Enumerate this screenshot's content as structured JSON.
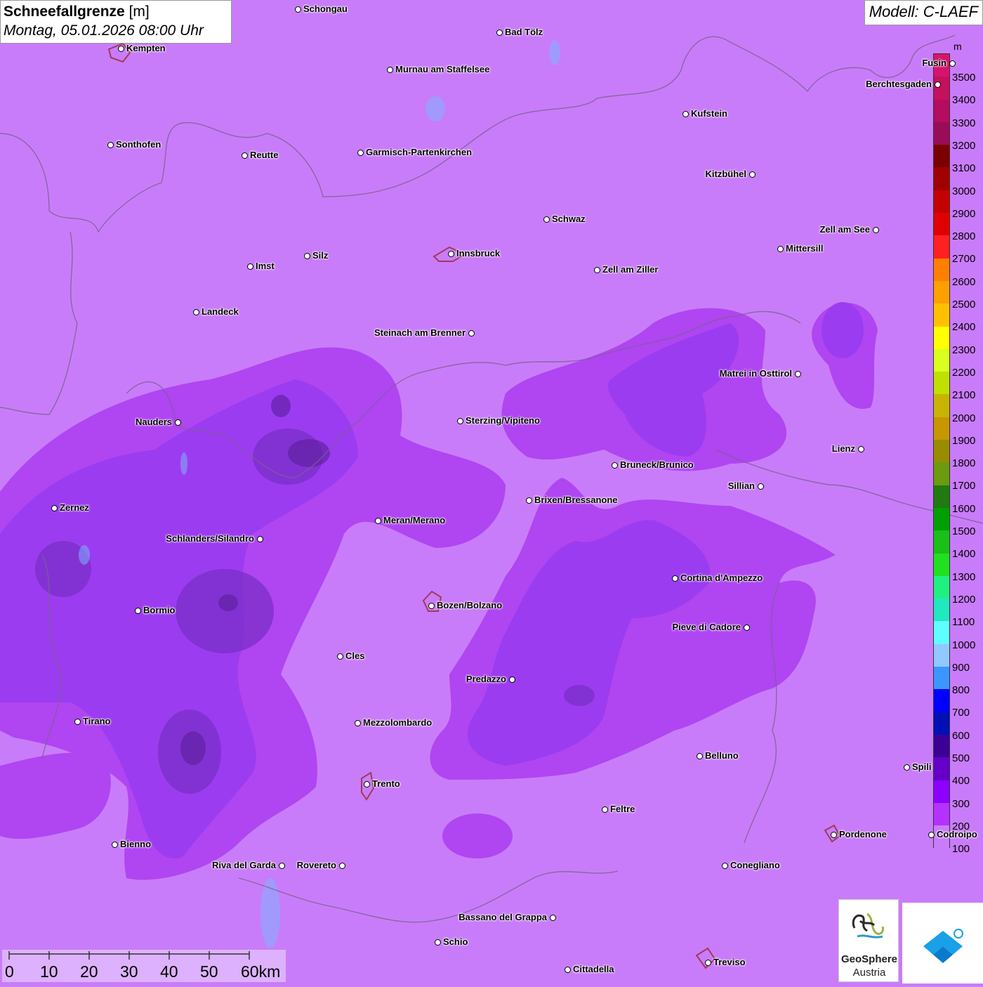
{
  "title": {
    "main": "Schneefallgrenze",
    "unit": "[m]",
    "datetime": "Montag, 05.01.2026 08:00 Uhr"
  },
  "model": "Modell: C-LAEF",
  "legend": {
    "unit": "m",
    "levels": [
      "3500",
      "3400",
      "3300",
      "3200",
      "3100",
      "3000",
      "2900",
      "2800",
      "2700",
      "2600",
      "2500",
      "2400",
      "2300",
      "2200",
      "2100",
      "2000",
      "1900",
      "1800",
      "1700",
      "1600",
      "1500",
      "1400",
      "1300",
      "1200",
      "1100",
      "1000",
      "900",
      "800",
      "700",
      "600",
      "500",
      "400",
      "300",
      "200",
      "100"
    ],
    "colors": [
      "#d6146e",
      "#c5105e",
      "#b30c60",
      "#9b0c58",
      "#7a0000",
      "#a10000",
      "#c40000",
      "#e00000",
      "#ff2020",
      "#ff7f00",
      "#ff9f00",
      "#ffc000",
      "#ffff00",
      "#d8ff1e",
      "#c0e000",
      "#c8b400",
      "#c89600",
      "#9a8c00",
      "#6c9a10",
      "#207a10",
      "#00a000",
      "#18c018",
      "#20e020",
      "#20f080",
      "#20e8c0",
      "#60ffff",
      "#90c8ff",
      "#3c96ff",
      "#0000ff",
      "#0010b4",
      "#3c0096",
      "#6400c8",
      "#8c00ff",
      "#b432ff",
      "#c97cf9"
    ]
  },
  "cities": [
    {
      "name": "Schongau"
    },
    {
      "name": "Kempten"
    },
    {
      "name": "Bad Tölz"
    },
    {
      "name": "Murnau am Staffelsee"
    },
    {
      "name": "Berchtesgaden"
    },
    {
      "name": "Kufstein"
    },
    {
      "name": "Sonthofen"
    },
    {
      "name": "Reutte"
    },
    {
      "name": "Garmisch-Partenkirchen"
    },
    {
      "name": "Kitzbühel"
    },
    {
      "name": "Schwaz"
    },
    {
      "name": "Zell am See"
    },
    {
      "name": "Mittersill"
    },
    {
      "name": "Innsbruck"
    },
    {
      "name": "Imst"
    },
    {
      "name": "Silz"
    },
    {
      "name": "Zell am Ziller"
    },
    {
      "name": "Landeck"
    },
    {
      "name": "Steinach am Brenner"
    },
    {
      "name": "Matrei in Osttirol"
    },
    {
      "name": "Nauders"
    },
    {
      "name": "Sterzing/Vipiteno"
    },
    {
      "name": "Lienz"
    },
    {
      "name": "Bruneck/Brunico"
    },
    {
      "name": "Sillian"
    },
    {
      "name": "Zernez"
    },
    {
      "name": "Brixen/Bressanone"
    },
    {
      "name": "Meran/Merano"
    },
    {
      "name": "Schlanders/Silandro"
    },
    {
      "name": "Cortina d'Ampezzo"
    },
    {
      "name": "Bozen/Bolzano"
    },
    {
      "name": "Bormio"
    },
    {
      "name": "Pieve di Cadore"
    },
    {
      "name": "Cles"
    },
    {
      "name": "Predazzo"
    },
    {
      "name": "Tirano"
    },
    {
      "name": "Mezzolombardo"
    },
    {
      "name": "Belluno"
    },
    {
      "name": "Spili"
    },
    {
      "name": "Trento"
    },
    {
      "name": "Feltre"
    },
    {
      "name": "Pordenone"
    },
    {
      "name": "Bienno"
    },
    {
      "name": "Riva del Garda"
    },
    {
      "name": "Rovereto"
    },
    {
      "name": "Conegliano"
    },
    {
      "name": "Bassano del Grappa"
    },
    {
      "name": "Schio"
    },
    {
      "name": "Cittadella"
    },
    {
      "name": "Treviso"
    },
    {
      "name": "Fusin"
    },
    {
      "name": "Codroipo"
    }
  ],
  "scale": {
    "labels": [
      "0",
      "10",
      "20",
      "30",
      "40",
      "50",
      "60km"
    ]
  },
  "logos": {
    "geosphere_line1": "GeoSphere",
    "geosphere_line2": "Austria"
  }
}
